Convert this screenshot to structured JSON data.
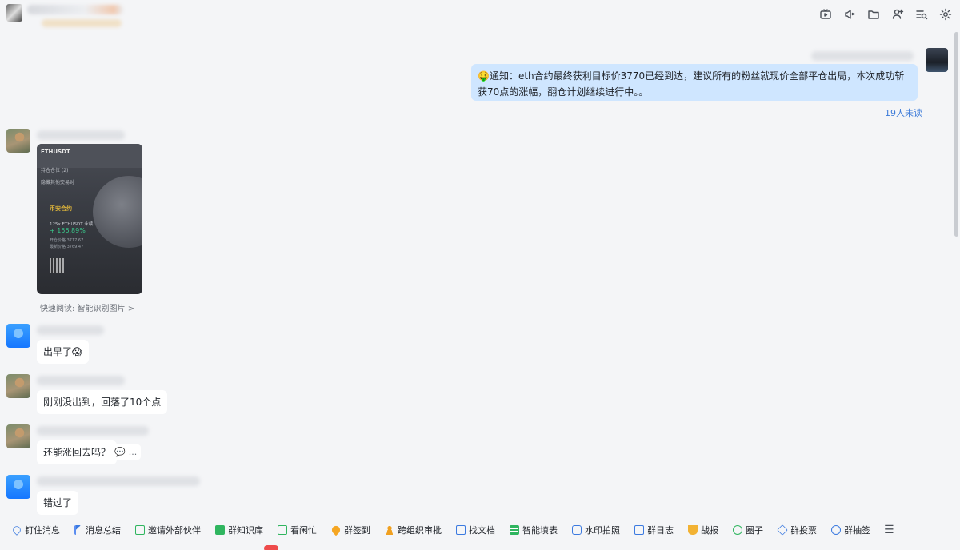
{
  "header": {
    "icons": [
      "live-icon",
      "speaker-icon",
      "folder-icon",
      "add-member-icon",
      "search-history-icon",
      "settings-icon"
    ]
  },
  "messages": {
    "notice": {
      "emoji": "🤑",
      "text": "通知：eth合约最终获利目标价3770已经到达，建议所有的粉丝就现价全部平仓出局，本次成功斩获70点的涨幅，翻仓计划继续进行中。。",
      "read_status": "19人未读"
    },
    "image_card": {
      "pair_title": "ETHUSDT",
      "tag1": "持仓仓位 (2)",
      "tag2": "隐藏其他交易对",
      "brand": "币安合约",
      "pair": "125x ETHUSDT 永续",
      "pct": "+ 156.89%",
      "row1": "开仓价格 3717.67",
      "row2": "最新价格 3769.47"
    },
    "quick_read": "快速阅读: 智能识别图片 >",
    "m1": "出早了😱",
    "m2": "刚刚没出到，回落了10个点",
    "m3": "还能涨回去吗？",
    "m4": "错过了",
    "hover_actions": [
      "💬",
      "..."
    ]
  },
  "toolbar": {
    "items": [
      {
        "label": "钉住消息",
        "icon": "pin-icon"
      },
      {
        "label": "消息总结",
        "icon": "magic-wand-icon"
      },
      {
        "label": "邀请外部伙伴",
        "icon": "invite-icon"
      },
      {
        "label": "群知识库",
        "icon": "knowledge-base-icon"
      },
      {
        "label": "看闲忙",
        "icon": "calendar-check-icon"
      },
      {
        "label": "群签到",
        "icon": "location-pin-icon"
      },
      {
        "label": "跨组织审批",
        "icon": "approval-icon"
      },
      {
        "label": "找文档",
        "icon": "document-search-icon"
      },
      {
        "label": "智能填表",
        "icon": "spreadsheet-icon"
      },
      {
        "label": "水印拍照",
        "icon": "camera-icon"
      },
      {
        "label": "群日志",
        "icon": "log-icon"
      },
      {
        "label": "战报",
        "icon": "trophy-icon"
      },
      {
        "label": "圈子",
        "icon": "circle-icon"
      },
      {
        "label": "群投票",
        "icon": "vote-icon"
      },
      {
        "label": "群抽签",
        "icon": "lottery-icon"
      }
    ],
    "menu": "☰"
  }
}
